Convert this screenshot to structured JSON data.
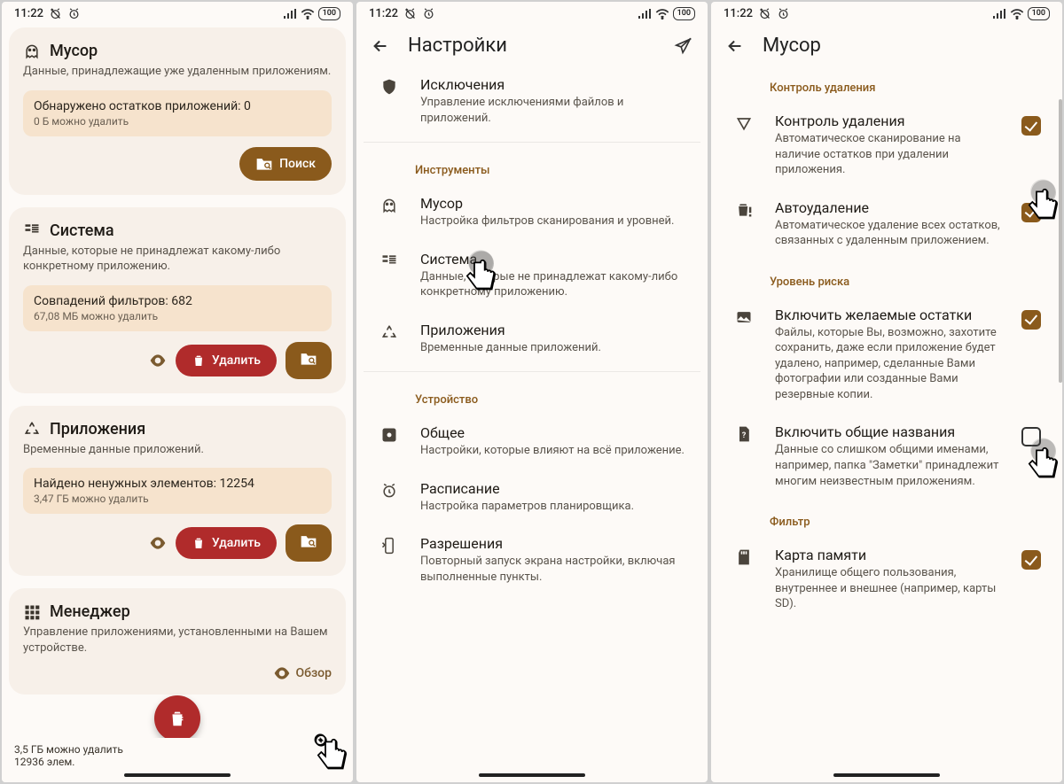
{
  "status": {
    "time": "11:22",
    "battery": "100"
  },
  "screen1": {
    "cards": [
      {
        "icon": "ghost",
        "title": "Мусор",
        "sub": "Данные, принадлежащие уже удаленным приложениям.",
        "stat1": "Обнаружено остатков приложений: 0",
        "stat2": "0 Б можно удалить",
        "action_label": "Поиск",
        "action_type": "search"
      },
      {
        "icon": "system",
        "title": "Система",
        "sub": "Данные, которые не принадлежат какому-либо конкретному приложению.",
        "stat1": "Совпадений фильтров: 682",
        "stat2": "67,08 МБ можно удалить",
        "action_label": "Удалить",
        "action_type": "delete"
      },
      {
        "icon": "recycle",
        "title": "Приложения",
        "sub": "Временные данные приложений.",
        "stat1": "Найдено ненужных элементов: 12254",
        "stat2": "3,47 ГБ можно удалить",
        "action_label": "Удалить",
        "action_type": "delete"
      },
      {
        "icon": "grid",
        "title": "Менеджер",
        "sub": "Управление приложениями, установленными на Вашем устройстве.",
        "review_label": "Обзор"
      }
    ],
    "bottom1": "3,5 ГБ можно удалить",
    "bottom2": "12936 элем."
  },
  "screen2": {
    "title": "Настройки",
    "sections": [
      {
        "items": [
          {
            "icon": "shield",
            "title": "Исключения",
            "sub": "Управление исключениями файлов и приложений."
          }
        ]
      },
      {
        "label": "Инструменты",
        "items": [
          {
            "icon": "ghost",
            "title": "Мусор",
            "sub": "Настройка фильтров сканирования и уровней."
          },
          {
            "icon": "system",
            "title": "Система",
            "sub": "Данные, которые не принадлежат какому-либо конкретному приложению."
          },
          {
            "icon": "recycle",
            "title": "Приложения",
            "sub": "Временные данные приложений."
          }
        ]
      },
      {
        "label": "Устройство",
        "items": [
          {
            "icon": "gear",
            "title": "Общее",
            "sub": "Настройки, которые влияют на всё приложение."
          },
          {
            "icon": "alarm",
            "title": "Расписание",
            "sub": "Настройка параметров планировщика."
          },
          {
            "icon": "phone",
            "title": "Разрешения",
            "sub": "Повторный запуск экрана настройки, включая выполненные пункты."
          }
        ]
      }
    ]
  },
  "screen3": {
    "title": "Мусор",
    "sections": [
      {
        "label": "Контроль удаления",
        "items": [
          {
            "icon": "triangle",
            "title": "Контроль удаления",
            "sub": "Автоматическое сканирование на наличие остатков при удалении приложения.",
            "checked": true
          },
          {
            "icon": "trashwarn",
            "title": "Автоудаление",
            "sub": "Автоматическое удаление всех остатков, связанных с удаленным приложением.",
            "checked": true
          }
        ]
      },
      {
        "label": "Уровень риска",
        "items": [
          {
            "icon": "image",
            "title": "Включить желаемые остатки",
            "sub": "Файлы, которые Вы, возможно, захотите сохранить, даже если приложение будет удалено, например, сделанные Вами фотографии или созданные Вами резервные копии.",
            "checked": true
          },
          {
            "icon": "filequestion",
            "title": "Включить общие названия",
            "sub": "Данные со слишком общими именами, например, папка \"Заметки\" принадлежит многим неизвестным приложениям.",
            "checked": false
          }
        ]
      },
      {
        "label": "Фильтр",
        "items": [
          {
            "icon": "sdcard",
            "title": "Карта памяти",
            "sub": "Хранилище общего пользования, внутреннее и внешнее (например, карты SD).",
            "checked": true
          }
        ]
      }
    ]
  }
}
